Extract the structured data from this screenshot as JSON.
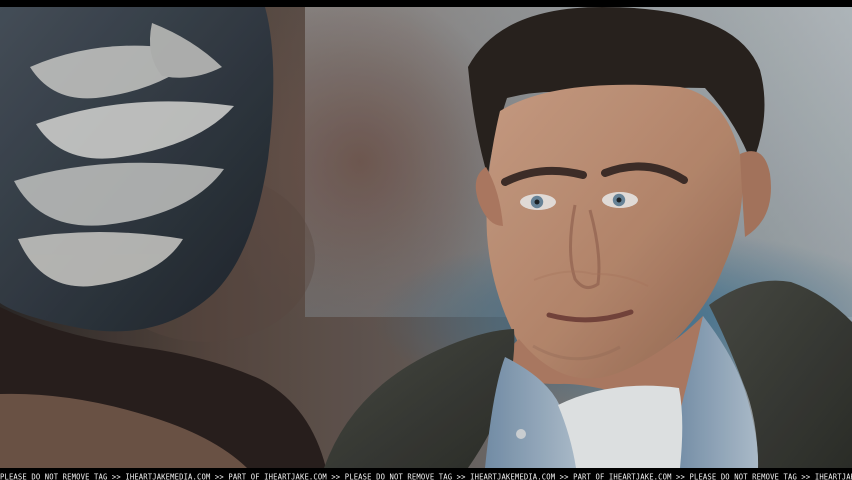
{
  "watermark": {
    "text": "PLEASE DO NOT REMOVE TAG >> IHEARTJAKEMEDIA.COM >> PART OF IHEARTJAKE.COM >> PLEASE DO NOT REMOVE TAG >> IHEARTJAKEMEDIA.COM >> PART OF IHEARTJAKE.COM >> PLEASE DO NOT REMOVE TAG >> IHEARTJAKE"
  }
}
